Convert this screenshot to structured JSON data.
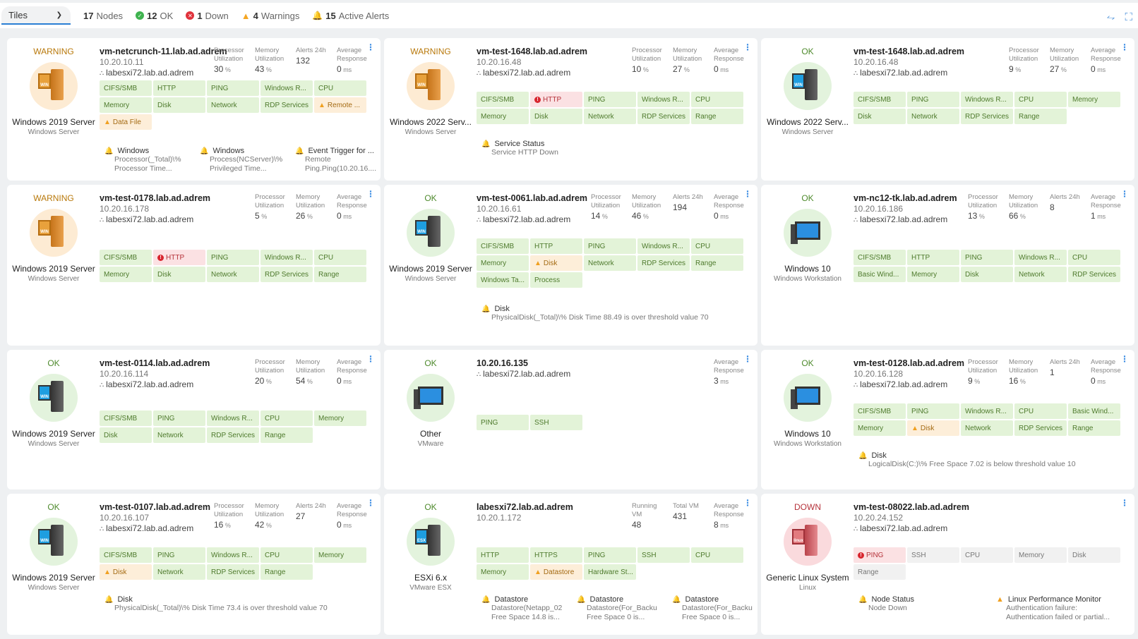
{
  "toolbar": {
    "view": "Tiles",
    "nodes_count": "17",
    "nodes_label": "Nodes",
    "ok_count": "12",
    "ok_label": "OK",
    "down_count": "1",
    "down_label": "Down",
    "warn_count": "4",
    "warn_label": "Warnings",
    "alerts_count": "15",
    "alerts_label": "Active Alerts"
  },
  "labels": {
    "proc": "Processor Utilization",
    "mem": "Memory Utilization",
    "alerts": "Alerts 24h",
    "resp": "Average Response",
    "running": "Running VM",
    "total": "Total VM",
    "pct": "%",
    "ms": "ms"
  },
  "tiles": [
    {
      "status": "WARNING",
      "type": "Windows 2019 Server",
      "subtype": "Windows Server",
      "name": "vm-netcrunch-11.lab.ad.adrem",
      "ip": "10.20.10.11",
      "parent": "labesxi72.lab.ad.adrem",
      "proc": "30",
      "mem": "43",
      "alerts": "132",
      "resp": "0",
      "monitors": [
        [
          "CIFS/SMB",
          "ok"
        ],
        [
          "HTTP",
          "ok"
        ],
        [
          "PING",
          "ok"
        ],
        [
          "Windows R...",
          "ok"
        ],
        [
          "CPU",
          "ok"
        ],
        [
          "Memory",
          "ok"
        ],
        [
          "Disk",
          "ok"
        ],
        [
          "Network",
          "ok"
        ],
        [
          "RDP Services",
          "ok"
        ],
        [
          "Remote ...",
          "warn"
        ],
        [
          "Data File",
          "warn"
        ]
      ],
      "alert_items": [
        {
          "title": "Windows",
          "desc": "Processor(_Total)\\% Processor Time..."
        },
        {
          "title": "Windows",
          "desc": "Process(NCServer)\\% Privileged Time..."
        },
        {
          "title": "Event Trigger for ...",
          "desc": "Remote Ping.Ping(10.20.16...."
        }
      ]
    },
    {
      "status": "WARNING",
      "type": "Windows 2022 Serv...",
      "subtype": "Windows Server",
      "name": "vm-test-1648.lab.ad.adrem",
      "ip": "10.20.16.48",
      "parent": "labesxi72.lab.ad.adrem",
      "proc": "10",
      "mem": "27",
      "resp": "0",
      "monitors": [
        [
          "CIFS/SMB",
          "ok"
        ],
        [
          "HTTP",
          "err"
        ],
        [
          "PING",
          "ok"
        ],
        [
          "Windows R...",
          "ok"
        ],
        [
          "CPU",
          "ok"
        ],
        [
          "Memory",
          "ok"
        ],
        [
          "Disk",
          "ok"
        ],
        [
          "Network",
          "ok"
        ],
        [
          "RDP Services",
          "ok"
        ],
        [
          "Range",
          "ok"
        ]
      ],
      "alert_items": [
        {
          "title": "Service Status",
          "desc": "Service HTTP Down"
        }
      ]
    },
    {
      "status": "OK",
      "type": "Windows 2022 Serv...",
      "subtype": "Windows Server",
      "name": "vm-test-1648.lab.ad.adrem",
      "ip": "10.20.16.48",
      "parent": "labesxi72.lab.ad.adrem",
      "proc": "9",
      "mem": "27",
      "resp": "0",
      "monitors": [
        [
          "CIFS/SMB",
          "ok"
        ],
        [
          "PING",
          "ok"
        ],
        [
          "Windows R...",
          "ok"
        ],
        [
          "CPU",
          "ok"
        ],
        [
          "Memory",
          "ok"
        ],
        [
          "Disk",
          "ok"
        ],
        [
          "Network",
          "ok"
        ],
        [
          "RDP Services",
          "ok"
        ],
        [
          "Range",
          "ok"
        ]
      ],
      "alert_items": []
    },
    {
      "status": "WARNING",
      "type": "Windows 2019 Server",
      "subtype": "Windows Server",
      "name": "vm-test-0178.lab.ad.adrem",
      "ip": "10.20.16.178",
      "parent": "labesxi72.lab.ad.adrem",
      "proc": "5",
      "mem": "26",
      "resp": "0",
      "monitors": [
        [
          "CIFS/SMB",
          "ok"
        ],
        [
          "HTTP",
          "err"
        ],
        [
          "PING",
          "ok"
        ],
        [
          "Windows R...",
          "ok"
        ],
        [
          "CPU",
          "ok"
        ],
        [
          "Memory",
          "ok"
        ],
        [
          "Disk",
          "ok"
        ],
        [
          "Network",
          "ok"
        ],
        [
          "RDP Services",
          "ok"
        ],
        [
          "Range",
          "ok"
        ]
      ],
      "alert_items": []
    },
    {
      "status": "OK",
      "type": "Windows 2019 Server",
      "subtype": "Windows Server",
      "name": "vm-test-0061.lab.ad.adrem",
      "ip": "10.20.16.61",
      "parent": "labesxi72.lab.ad.adrem",
      "proc": "14",
      "mem": "46",
      "alerts": "194",
      "resp": "0",
      "monitors": [
        [
          "CIFS/SMB",
          "ok"
        ],
        [
          "HTTP",
          "ok"
        ],
        [
          "PING",
          "ok"
        ],
        [
          "Windows R...",
          "ok"
        ],
        [
          "CPU",
          "ok"
        ],
        [
          "Memory",
          "ok"
        ],
        [
          "Disk",
          "warn"
        ],
        [
          "Network",
          "ok"
        ],
        [
          "RDP Services",
          "ok"
        ],
        [
          "Range",
          "ok"
        ],
        [
          "Windows Ta...",
          "ok"
        ],
        [
          "Process",
          "ok"
        ]
      ],
      "alert_items": [
        {
          "title": "Disk",
          "desc": "PhysicalDisk(_Total)\\% Disk Time 88.49 is over threshold value 70"
        }
      ]
    },
    {
      "status": "OK",
      "type": "Windows 10",
      "subtype": "Windows Workstation",
      "name": "vm-nc12-tk.lab.ad.adrem",
      "ip": "10.20.16.186",
      "parent": "labesxi72.lab.ad.adrem",
      "proc": "13",
      "mem": "66",
      "alerts": "8",
      "resp": "1",
      "monitors": [
        [
          "CIFS/SMB",
          "ok"
        ],
        [
          "HTTP",
          "ok"
        ],
        [
          "PING",
          "ok"
        ],
        [
          "Windows R...",
          "ok"
        ],
        [
          "CPU",
          "ok"
        ],
        [
          "Basic Wind...",
          "ok"
        ],
        [
          "Memory",
          "ok"
        ],
        [
          "Disk",
          "ok"
        ],
        [
          "Network",
          "ok"
        ],
        [
          "RDP Services",
          "ok"
        ]
      ],
      "alert_items": []
    },
    {
      "status": "OK",
      "type": "Windows 2019 Server",
      "subtype": "Windows Server",
      "name": "vm-test-0114.lab.ad.adrem",
      "ip": "10.20.16.114",
      "parent": "labesxi72.lab.ad.adrem",
      "proc": "20",
      "mem": "54",
      "resp": "0",
      "monitors": [
        [
          "CIFS/SMB",
          "ok"
        ],
        [
          "PING",
          "ok"
        ],
        [
          "Windows R...",
          "ok"
        ],
        [
          "CPU",
          "ok"
        ],
        [
          "Memory",
          "ok"
        ],
        [
          "Disk",
          "ok"
        ],
        [
          "Network",
          "ok"
        ],
        [
          "RDP Services",
          "ok"
        ],
        [
          "Range",
          "ok"
        ]
      ],
      "alert_items": []
    },
    {
      "status": "OK",
      "type": "Other",
      "subtype": "VMware",
      "name": "10.20.16.135",
      "parent": "labesxi72.lab.ad.adrem",
      "resp": "3",
      "monitors": [
        [
          "PING",
          "ok"
        ],
        [
          "SSH",
          "ok"
        ]
      ],
      "alert_items": []
    },
    {
      "status": "OK",
      "type": "Windows 10",
      "subtype": "Windows Workstation",
      "name": "vm-test-0128.lab.ad.adrem",
      "ip": "10.20.16.128",
      "parent": "labesxi72.lab.ad.adrem",
      "proc": "9",
      "mem": "16",
      "alerts": "1",
      "resp": "0",
      "monitors": [
        [
          "CIFS/SMB",
          "ok"
        ],
        [
          "PING",
          "ok"
        ],
        [
          "Windows R...",
          "ok"
        ],
        [
          "CPU",
          "ok"
        ],
        [
          "Basic Wind...",
          "ok"
        ],
        [
          "Memory",
          "ok"
        ],
        [
          "Disk",
          "warn"
        ],
        [
          "Network",
          "ok"
        ],
        [
          "RDP Services",
          "ok"
        ],
        [
          "Range",
          "ok"
        ]
      ],
      "alert_items": [
        {
          "title": "Disk",
          "desc": "LogicalDisk(C:)\\% Free Space 7.02 is below threshold value 10"
        }
      ]
    },
    {
      "status": "OK",
      "type": "Windows 2019 Server",
      "subtype": "Windows Server",
      "name": "vm-test-0107.lab.ad.adrem",
      "ip": "10.20.16.107",
      "parent": "labesxi72.lab.ad.adrem",
      "proc": "16",
      "mem": "42",
      "alerts": "27",
      "resp": "0",
      "monitors": [
        [
          "CIFS/SMB",
          "ok"
        ],
        [
          "PING",
          "ok"
        ],
        [
          "Windows R...",
          "ok"
        ],
        [
          "CPU",
          "ok"
        ],
        [
          "Memory",
          "ok"
        ],
        [
          "Disk",
          "warn"
        ],
        [
          "Network",
          "ok"
        ],
        [
          "RDP Services",
          "ok"
        ],
        [
          "Range",
          "ok"
        ]
      ],
      "alert_items": [
        {
          "title": "Disk",
          "desc": "PhysicalDisk(_Total)\\% Disk Time 73.4 is over threshold value 70"
        }
      ]
    },
    {
      "status": "OK",
      "type": "ESXi 6.x",
      "subtype": "VMware ESX",
      "name": "labesxi72.lab.ad.adrem",
      "ip": "10.20.1.172",
      "running": "48",
      "total": "431",
      "resp": "8",
      "monitors": [
        [
          "HTTP",
          "ok"
        ],
        [
          "HTTPS",
          "ok"
        ],
        [
          "PING",
          "ok"
        ],
        [
          "SSH",
          "ok"
        ],
        [
          "CPU",
          "ok"
        ],
        [
          "Memory",
          "ok"
        ],
        [
          "Datastore",
          "warn"
        ],
        [
          "Hardware St...",
          "ok"
        ]
      ],
      "alert_items": [
        {
          "title": "Datastore",
          "desc": "Datastore(Netapp_02 Free Space 14.8 is..."
        },
        {
          "title": "Datastore",
          "desc": "Datastore(For_Backu Free Space 0 is..."
        },
        {
          "title": "Datastore",
          "desc": "Datastore(For_Backu Free Space 0 is..."
        }
      ]
    },
    {
      "status": "DOWN",
      "type": "Generic Linux System",
      "subtype": "Linux",
      "name": "vm-test-08022.lab.ad.adrem",
      "ip": "10.20.24.152",
      "parent": "labesxi72.lab.ad.adrem",
      "monitors": [
        [
          "PING",
          "err"
        ],
        [
          "SSH",
          "gray"
        ],
        [
          "CPU",
          "gray"
        ],
        [
          "Memory",
          "gray"
        ],
        [
          "Disk",
          "gray"
        ],
        [
          "Range",
          "gray"
        ]
      ],
      "alert_items": [
        {
          "title": "Node Status",
          "desc": "Node Down"
        },
        {
          "title": "Linux Performance Monitor",
          "desc": "Authentication failure: Authentication failed or partial...",
          "warn": true
        }
      ]
    }
  ]
}
